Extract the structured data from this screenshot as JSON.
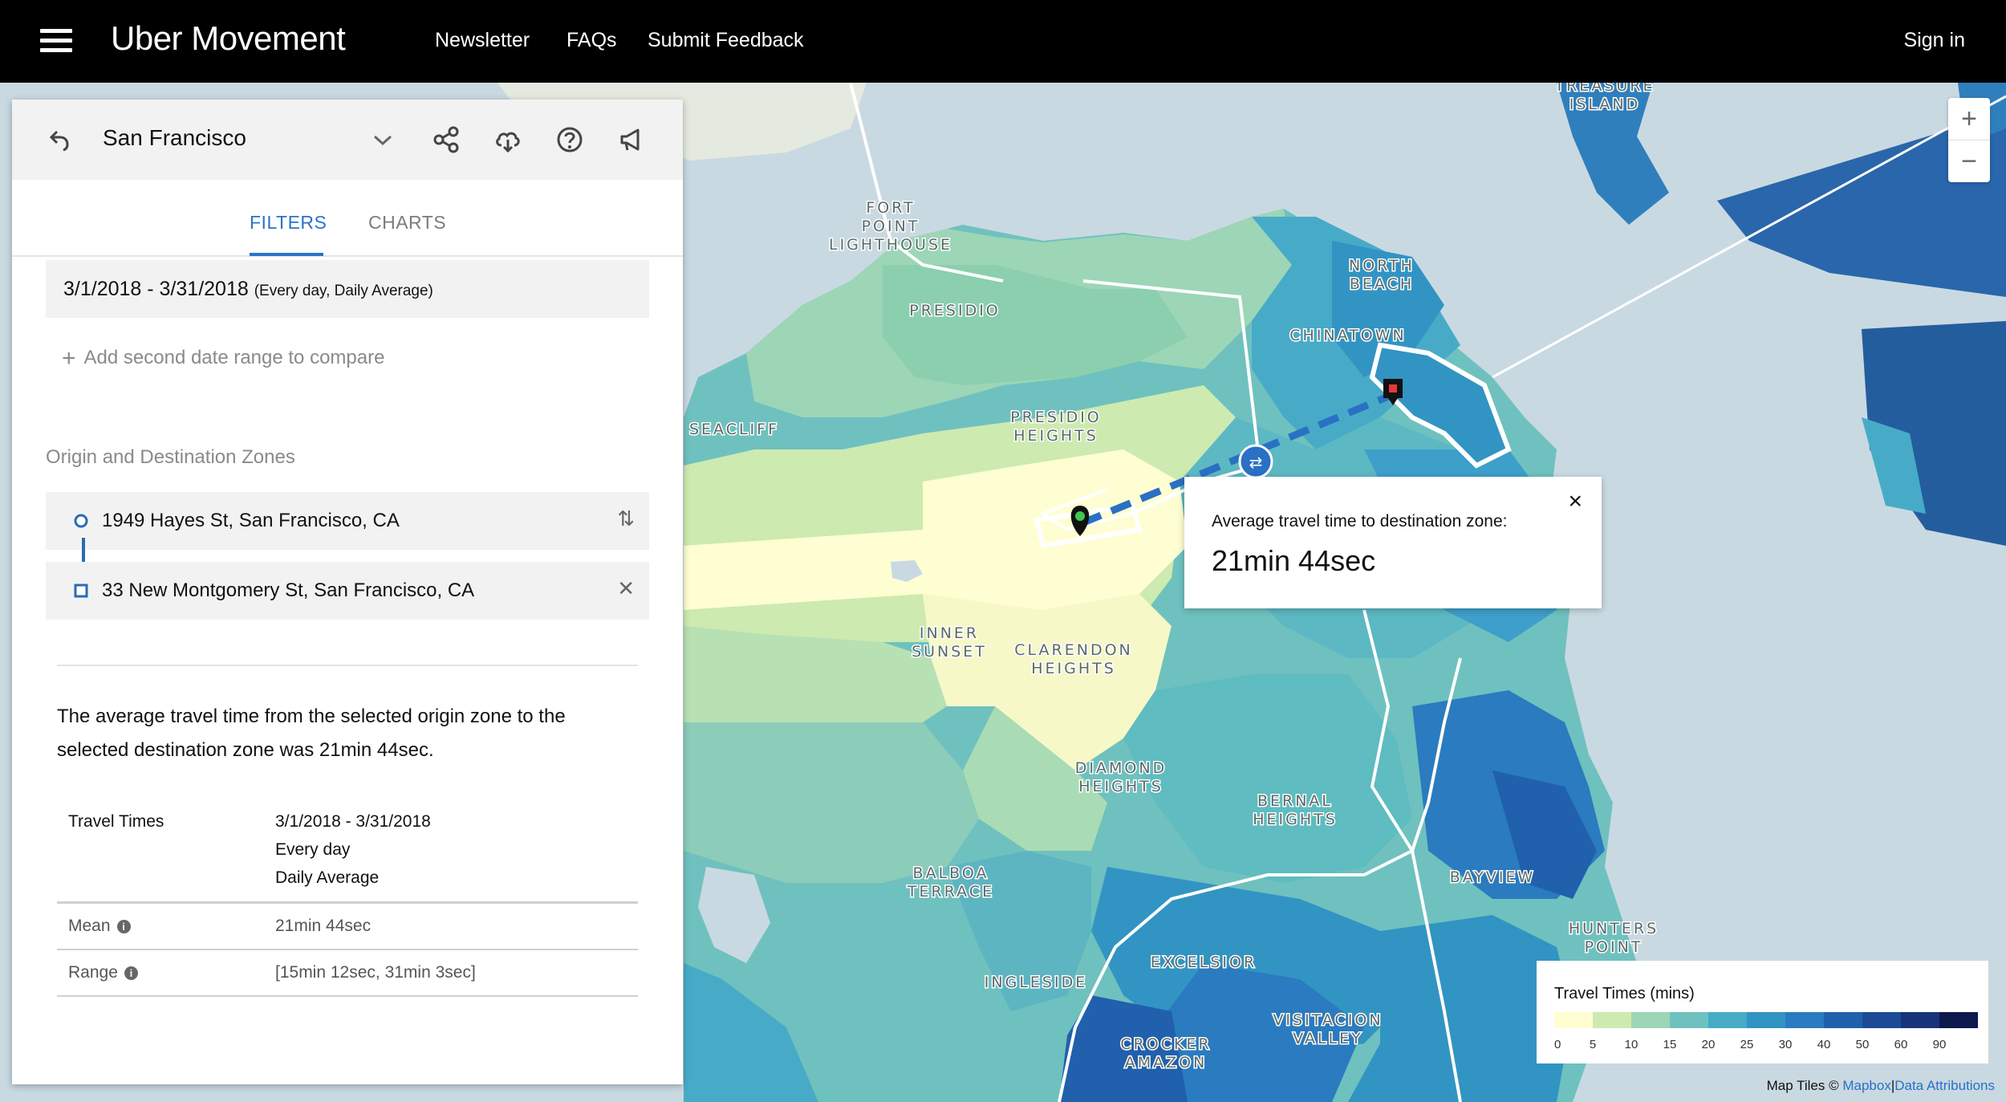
{
  "nav": {
    "brand": "Uber Movement",
    "links": [
      "Newsletter",
      "FAQs",
      "Submit Feedback"
    ],
    "signin": "Sign in"
  },
  "panel": {
    "city": "San Francisco",
    "tabs": [
      "FILTERS",
      "CHARTS"
    ],
    "date_range": "3/1/2018 - 3/31/2018",
    "date_note": "(Every day, Daily Average)",
    "add_range": "Add second date range to compare",
    "zones_title": "Origin and Destination Zones",
    "origin": "1949 Hayes St, San Francisco, CA",
    "destination": "33 New Montgomery St, San Francisco, CA",
    "summary": "The average travel time from the selected origin zone to the selected destination zone was 21min 44sec.",
    "table": {
      "header_label": "Travel Times",
      "header_lines": [
        "3/1/2018 - 3/31/2018",
        "Every day",
        "Daily Average"
      ],
      "rows": [
        {
          "label": "Mean",
          "value": "21min 44sec"
        },
        {
          "label": "Range",
          "value": "[15min 12sec, 31min 3sec]"
        }
      ]
    }
  },
  "tooltip": {
    "label": "Average travel time to destination zone:",
    "value": "21min 44sec",
    "close": "×"
  },
  "zoom": {
    "in": "+",
    "out": "−"
  },
  "legend": {
    "title": "Travel Times (mins)",
    "ticks": [
      "0",
      "5",
      "10",
      "15",
      "20",
      "25",
      "30",
      "40",
      "50",
      "60",
      "90"
    ],
    "colors": [
      "#fffed2",
      "#cdeab0",
      "#9dd5b7",
      "#6fc1bf",
      "#47abc8",
      "#3294c3",
      "#2a7bbf",
      "#2060ad",
      "#1c4a96",
      "#17337a",
      "#0c1a4e"
    ]
  },
  "attribution": {
    "prefix": "Map Tiles ©",
    "mapbox": "Mapbox",
    "separator": "|",
    "data": "Data Attributions"
  },
  "map_labels": [
    "TREASURE ISLAND",
    "FORT POINT LIGHTHOUSE",
    "PRESIDIO",
    "NORTH BEACH",
    "CHINATOWN",
    "SEACLIFF",
    "PRESIDIO HEIGHTS",
    "INNER SUNSET",
    "CLARENDON HEIGHTS",
    "DIAMOND HEIGHTS",
    "BERNAL HEIGHTS",
    "BALBOA TERRACE",
    "BAYVIEW",
    "HUNTERS POINT",
    "EXCELSIOR",
    "INGLESIDE",
    "VISITACION VALLEY",
    "CROCKER AMAZON"
  ]
}
